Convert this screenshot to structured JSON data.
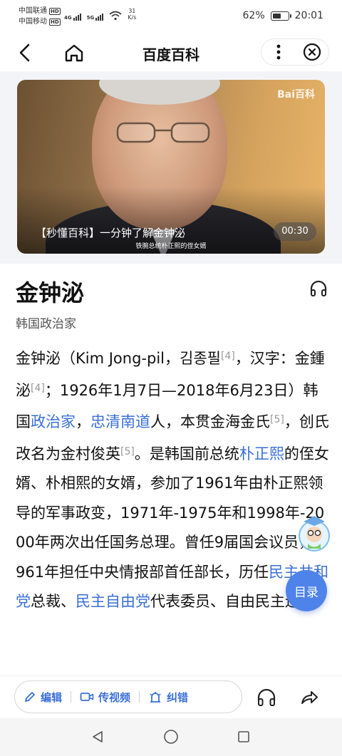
{
  "status_bar": {
    "carrier1": "中国联通",
    "carrier2": "中国移动",
    "hd_badge": "HD",
    "net_4g": "4G",
    "net_5g": "5G",
    "net_speed_value": "31",
    "net_speed_unit": "K/s",
    "battery": "62%",
    "battery_level": 0.62,
    "time": "20:01"
  },
  "nav": {
    "title": "百度百科"
  },
  "video": {
    "watermark": "Bai百科",
    "title": "【秒懂百科】一分钟了解金钟泌",
    "subtitle_caption": "铁腕总统朴正熙的侄女婿",
    "duration": "00:30"
  },
  "entry": {
    "title": "金钟泌",
    "subtitle": "韩国政治家"
  },
  "body": {
    "t1": "金钟泌（Kim Jong-pil，김종필",
    "r1": "[4]",
    "t2": "，汉字：金鍾泌",
    "r2": "[4]",
    "t3": "；1926年1月7日—2018年6月23日）韩国",
    "l1": "政治家",
    "t4": "，",
    "l2": "忠清南道",
    "t5": "人，本贯金海金氏",
    "r3": "[5]",
    "t6": "，创氏改名为金村俊英",
    "r4": "[5]",
    "t7": "。是韩国前总统",
    "l3": "朴正熙",
    "t8": "的侄女婿、朴相熙的女婿，参加了1961年由朴正熙领导的军事政变，1971年-1975年和1998年-2000年两次出任国务总理。曾任9届国会议员，1961年担任中央情报部首任部长，历任",
    "l4": "民主共和党",
    "t9": "总裁、",
    "l5": "民主自由党",
    "t10": "代表委员、自由民主连"
  },
  "floating": {
    "toc_label": "目录"
  },
  "toolbar": {
    "edit_label": "编辑",
    "video_label": "传视频",
    "correct_label": "纠错"
  },
  "colors": {
    "link": "#3a6fd8",
    "toc_button": "#4e83e9"
  }
}
